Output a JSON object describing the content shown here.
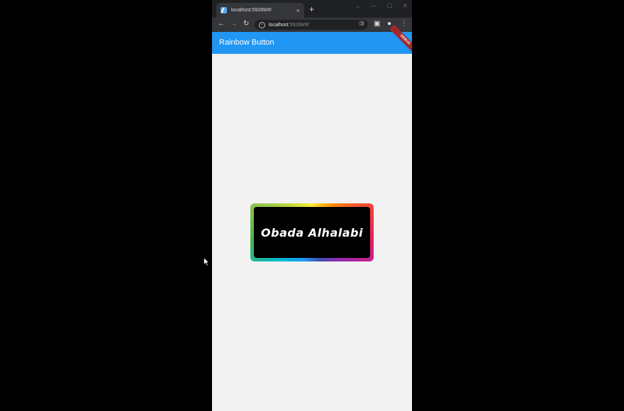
{
  "browser": {
    "tab_title": "localhost:59289/#/",
    "tab_close": "×",
    "new_tab": "+",
    "url_host": "localhost",
    "url_rest": ":59289/#/",
    "nav_back": "←",
    "nav_forward": "→",
    "nav_reload": "↻",
    "controls": [
      "⌄",
      "—",
      "☐",
      "✕"
    ],
    "toolbar_icons": [
      "⇪",
      "☆",
      "▣",
      "●",
      "⋮"
    ]
  },
  "app": {
    "title": "Rainbow Button",
    "debug_banner": "DEBUG",
    "appbar_color": "#2196f3"
  },
  "button": {
    "label": "Obada Alhalabi",
    "border": "rainbow",
    "fill_color": "#000000",
    "text_color": "#ffffff"
  }
}
